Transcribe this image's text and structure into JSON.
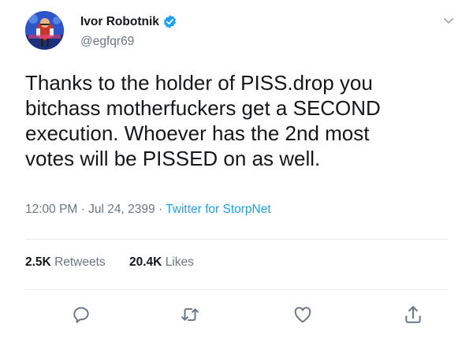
{
  "author": {
    "display_name": "Ivor Robotnik",
    "handle": "@egfqr69",
    "verified": true,
    "avatar_icon": "avatar-image"
  },
  "tweet": {
    "text": "Thanks to the holder of PISS.drop you\nbitchass motherfuckers get a SECOND\nexecution. Whoever has the 2nd most\nvotes will be PISSED on as well."
  },
  "meta": {
    "time": "12:00 PM",
    "date": "Jul 24, 2399",
    "separator": "·",
    "source": "Twitter for StorpNet"
  },
  "stats": {
    "retweets_count": "2.5K",
    "retweets_label": "Retweets",
    "likes_count": "20.4K",
    "likes_label": "Likes"
  },
  "actions": [
    "reply-icon",
    "retweet-icon",
    "like-icon",
    "share-icon"
  ],
  "colors": {
    "accent": "#1da1f2",
    "text": "#14171a",
    "secondary_text": "#657786",
    "divider": "#e6ecf0"
  }
}
